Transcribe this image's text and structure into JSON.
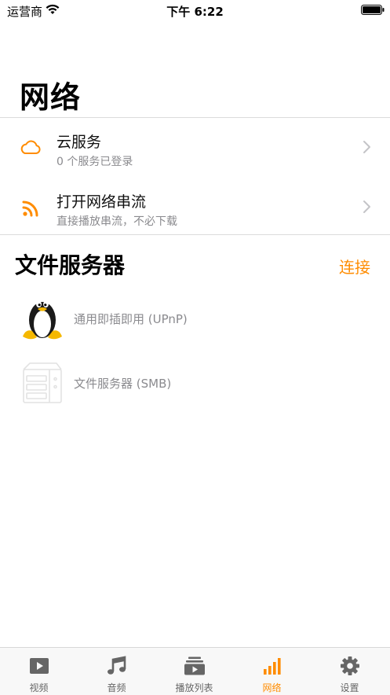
{
  "status_bar": {
    "carrier": "运营商",
    "time": "下午 6:22"
  },
  "page": {
    "title": "网络"
  },
  "nav_rows": [
    {
      "title": "云服务",
      "subtitle": "0 个服务已登录",
      "icon": "cloud-icon"
    },
    {
      "title": "打开网络串流",
      "subtitle": "直接播放串流，不必下载",
      "icon": "rss-icon"
    }
  ],
  "file_servers": {
    "title": "文件服务器",
    "action": "连接",
    "items": [
      {
        "label": "通用即插即用 (UPnP)",
        "icon": "linux-penguin-icon"
      },
      {
        "label": "文件服务器 (SMB)",
        "icon": "nas-server-icon"
      }
    ]
  },
  "tabs": [
    {
      "label": "视频",
      "icon": "video-icon",
      "active": false
    },
    {
      "label": "音频",
      "icon": "music-note-icon",
      "active": false
    },
    {
      "label": "播放列表",
      "icon": "playlist-icon",
      "active": false
    },
    {
      "label": "网络",
      "icon": "network-bars-icon",
      "active": true
    },
    {
      "label": "设置",
      "icon": "gear-icon",
      "active": false
    }
  ],
  "colors": {
    "accent": "#ff8c00",
    "secondary_text": "#8a8a8e",
    "tab_inactive": "#666666"
  }
}
